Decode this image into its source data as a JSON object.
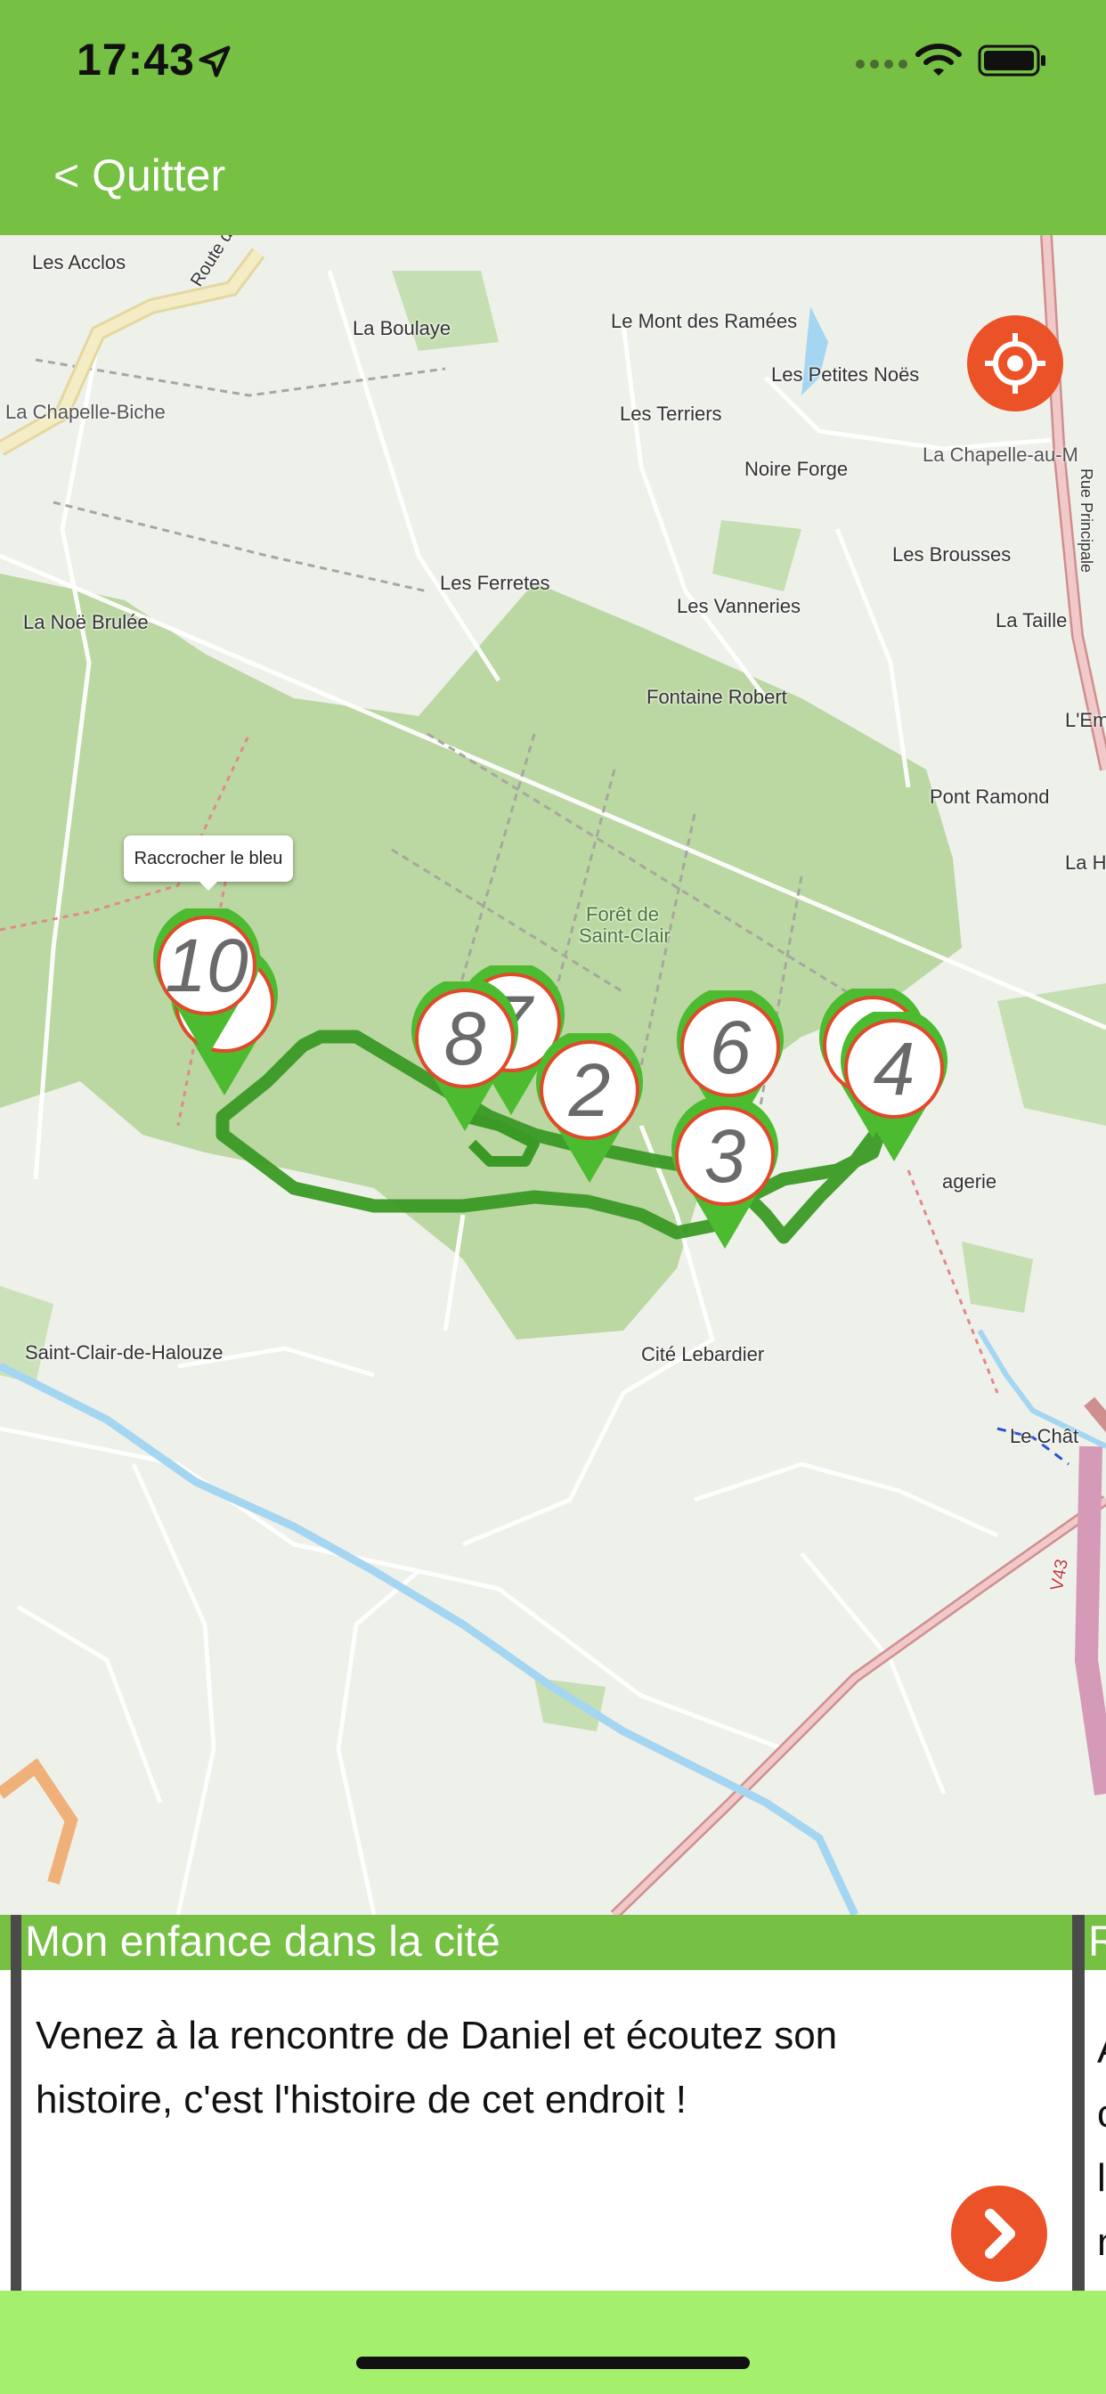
{
  "status_bar": {
    "time": "17:43"
  },
  "nav": {
    "quit_label": "< Quitter"
  },
  "map": {
    "labels": {
      "les_acclos": "Les Acclos",
      "route_de_ger": "Route de Ger",
      "la_boulaye": "La Boulaye",
      "le_mont_des_ramees": "Le Mont des Ramées",
      "les_petites_noes": "Les Petites Noës",
      "la_chapelle_biche": "La Chapelle-Biche",
      "les_terriers": "Les Terriers",
      "noire_forge": "Noire Forge",
      "la_chapelle_au": "La Chapelle-au-M",
      "rue_principale": "Rue Principale",
      "les_brousses": "Les Brousses",
      "les_ferretes": "Les Ferretes",
      "les_vanneries": "Les Vanneries",
      "la_noe_brulee": "La Noë Brulée",
      "la_taille": "La Taille",
      "fontaine_robert": "Fontaine Robert",
      "l_em": "L'Em",
      "pont_ramond": "Pont Ramond",
      "la_h": "La H",
      "foret_1": "Forêt de",
      "foret_2": "Saint-Clair",
      "cagerie": "agerie",
      "saint_clair": "Saint-Clair-de-Halouze",
      "cite_lebardier": "Cité Lebardier",
      "le_chate": "Le Chât",
      "v43": "V43"
    },
    "tooltip": "Raccrocher le bleu",
    "pins": [
      "10",
      "8",
      "7",
      "2",
      "6",
      "3",
      "5",
      "4"
    ],
    "colors": {
      "route": "#3a9a25",
      "pin_green": "#4cbb30",
      "pin_ring": "#e04a2a",
      "accent": "#ec5227",
      "header": "#76c043",
      "footer": "#a4f06d"
    }
  },
  "cards": [
    {
      "title": "Mon enfance dans la cité",
      "line1": "Venez à la rencontre de Daniel et écoutez son",
      "line2": "histoire, c'est l'histoire de cet endroit !"
    },
    {
      "title": "R",
      "lines": [
        "A",
        "c",
        "l",
        "n"
      ]
    }
  ],
  "icons": {
    "location": "location-arrow-icon",
    "signal": "cellular-signal-icon",
    "wifi": "wifi-icon",
    "battery": "battery-icon",
    "locate": "crosshair-icon",
    "next": "chevron-right-icon"
  }
}
